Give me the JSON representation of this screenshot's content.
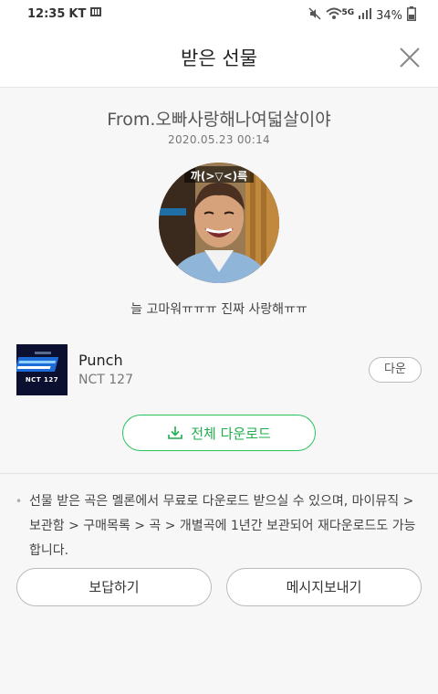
{
  "status_bar": {
    "time": "12:35",
    "carrier": "KT",
    "battery": "34%",
    "network": "5G"
  },
  "header": {
    "title": "받은 선물",
    "close_icon": "close-icon"
  },
  "gift": {
    "from": "From.오빠사랑해나여덟살이야",
    "date": "2020.05.23 00:14",
    "photo_caption": "까(>▽<)륵",
    "message": "늘 고마워ㅠㅠㅠ 진짜 사랑해ㅠㅠ"
  },
  "song": {
    "title": "Punch",
    "artist": "NCT 127",
    "album_text": "NCT 127",
    "download_label": "다운"
  },
  "download_all": {
    "label": "전체 다운로드",
    "icon": "download-icon",
    "accent_color": "#29c25b"
  },
  "notice": {
    "text": "선물 받은 곡은 멜론에서 무료로 다운로드 받으실 수 있으며, 마이뮤직 > 보관함 > 구매목록 > 곡 > 개별곡에 1년간 보관되어 재다운로드도 가능합니다."
  },
  "actions": {
    "reply_label": "보답하기",
    "send_message_label": "메시지보내기"
  }
}
